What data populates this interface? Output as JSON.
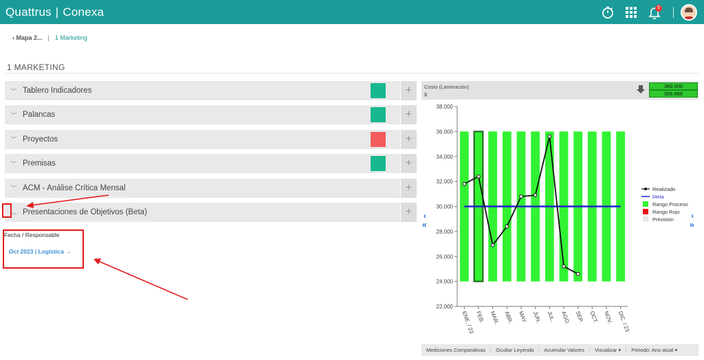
{
  "app": {
    "brand_left": "Quattrus",
    "brand_sep": "|",
    "brand_right": "Conexa",
    "notification_count": "5"
  },
  "breadcrumb": {
    "back": "Mapa 2...",
    "separator": "|",
    "current": "1 Marketing"
  },
  "page": {
    "title": "1 MARKETING"
  },
  "accordion": [
    {
      "label": "Tablero Indicadores",
      "status": "green"
    },
    {
      "label": "Palancas",
      "status": "green"
    },
    {
      "label": "Proyectos",
      "status": "red"
    },
    {
      "label": "Premisas",
      "status": "green"
    },
    {
      "label": "ACM - Análise Crítica Mensal",
      "status": ""
    },
    {
      "label": "Presentaciones de Objetivos (Beta)",
      "status": ""
    }
  ],
  "colors": {
    "brand": "#1b9c9a",
    "status_green": "#17b890",
    "status_red": "#f25c5c",
    "annotation_red": "#e21b1b",
    "bar_green": "#33f233",
    "meta_line": "#2020d0"
  },
  "detail": {
    "header": "Fecha / Responsable",
    "link": "Oct 2023 | Logística →"
  },
  "chart_header": {
    "title": "Costo (Laminación)",
    "unit": "$",
    "value_top": "360.000",
    "value_bottom": "356.666"
  },
  "chart_data": {
    "type": "bar",
    "categories": [
      "ENE. / 23",
      "FEB.",
      "MAR.",
      "ABR.",
      "MAY.",
      "JUN.",
      "JUL.",
      "AGO.",
      "SEP.",
      "OCT.",
      "NOV.",
      "DIC. / 23"
    ],
    "ylim": [
      22000,
      38000
    ],
    "yticks": [
      "22.000",
      "24.000",
      "26.000",
      "28.000",
      "30.000",
      "32.000",
      "34.000",
      "36.000",
      "38.000"
    ],
    "range_bars": {
      "name": "Rango Proceso",
      "low": 24000,
      "high": 36000
    },
    "selected_category": "FEB.",
    "series": [
      {
        "name": "Realizado",
        "type": "line",
        "values": [
          31800,
          32400,
          26900,
          28400,
          30800,
          30900,
          35600,
          25200,
          24600,
          null,
          null,
          null
        ]
      },
      {
        "name": "Meta",
        "type": "line",
        "values": [
          30000,
          30000,
          30000,
          30000,
          30000,
          30000,
          30000,
          30000,
          30000,
          30000,
          30000,
          30000
        ]
      }
    ],
    "legend": [
      "Realizado",
      "Meta",
      "Rango Proceso",
      "Rango Rojo",
      "Previsión"
    ],
    "legend_position": "right",
    "grid": false
  },
  "bottom_bar": [
    "Mediciones Comparativas",
    "Ocultar Leyenda",
    "Acumular Valores",
    "Visualizar ▾",
    "Periodo: Ano atual ▾"
  ]
}
